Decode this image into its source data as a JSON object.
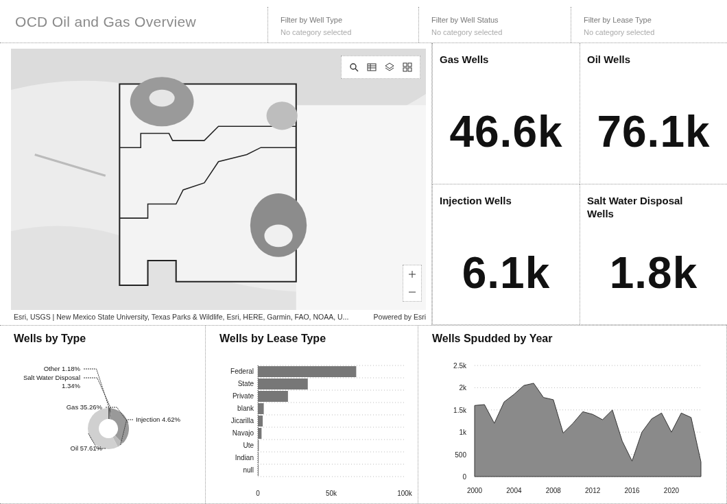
{
  "header": {
    "title": "OCD Oil and Gas Overview",
    "filters": [
      {
        "label": "Filter by Well Type",
        "placeholder": "No category selected"
      },
      {
        "label": "Filter by Well Status",
        "placeholder": "No category selected"
      },
      {
        "label": "Filter by Lease Type",
        "placeholder": "No category selected"
      }
    ]
  },
  "map": {
    "attribution": "Esri, USGS | New Mexico State University, Texas Parks & Wildlife, Esri, HERE, Garmin, FAO, NOAA, U...",
    "powered_by": "Powered by Esri"
  },
  "kpis": [
    {
      "title": "Gas Wells",
      "value": "46.6k"
    },
    {
      "title": "Oil Wells",
      "value": "76.1k"
    },
    {
      "title": "Injection Wells",
      "value": "6.1k"
    },
    {
      "title": "Salt Water Disposal Wells",
      "value": "1.8k"
    }
  ],
  "charts": [
    {
      "chart_data": {
        "type": "donut",
        "title": "Wells by Type",
        "categories": [
          "Other",
          "Salt Water Disposal",
          "Gas",
          "Injection",
          "Oil"
        ],
        "values": [
          1.18,
          1.34,
          35.26,
          4.62,
          57.61
        ],
        "value_labels": [
          "1.18%",
          "1.34%",
          "35.26%",
          "4.62%",
          "57.61%"
        ]
      }
    },
    {
      "chart_data": {
        "type": "bar",
        "orientation": "horizontal",
        "title": "Wells by Lease Type",
        "categories": [
          "Federal",
          "State",
          "Private",
          "blank",
          "Jicarilla",
          "Navajo",
          "Ute",
          "Indian",
          "null"
        ],
        "values": [
          67000,
          34000,
          20500,
          4000,
          3300,
          2500,
          600,
          400,
          100
        ],
        "xlim": [
          0,
          100000
        ],
        "xticks": [
          {
            "value": 0,
            "label": "0"
          },
          {
            "value": 50000,
            "label": "50k"
          },
          {
            "value": 100000,
            "label": "100k"
          }
        ]
      }
    },
    {
      "chart_data": {
        "type": "area",
        "title": "Wells Spudded by Year",
        "x": [
          2000,
          2001,
          2002,
          2003,
          2004,
          2005,
          2006,
          2007,
          2008,
          2009,
          2010,
          2011,
          2012,
          2013,
          2014,
          2015,
          2016,
          2017,
          2018,
          2019,
          2020,
          2021,
          2022,
          2023
        ],
        "values": [
          1600,
          1620,
          1200,
          1680,
          1850,
          2050,
          2100,
          1780,
          1730,
          980,
          1200,
          1460,
          1400,
          1280,
          1500,
          800,
          350,
          1000,
          1300,
          1430,
          1000,
          1430,
          1330,
          330
        ],
        "xlim": [
          2000,
          2023
        ],
        "grid": true,
        "ylim": [
          0,
          2500
        ],
        "xticks": [
          2000,
          2004,
          2008,
          2012,
          2016,
          2020
        ],
        "yticks": [
          {
            "value": 0,
            "label": "0"
          },
          {
            "value": 500,
            "label": "500"
          },
          {
            "value": 1000,
            "label": "1k"
          },
          {
            "value": 1500,
            "label": "1.5k"
          },
          {
            "value": 2000,
            "label": "2k"
          },
          {
            "value": 2500,
            "label": "2.5k"
          }
        ]
      }
    }
  ]
}
